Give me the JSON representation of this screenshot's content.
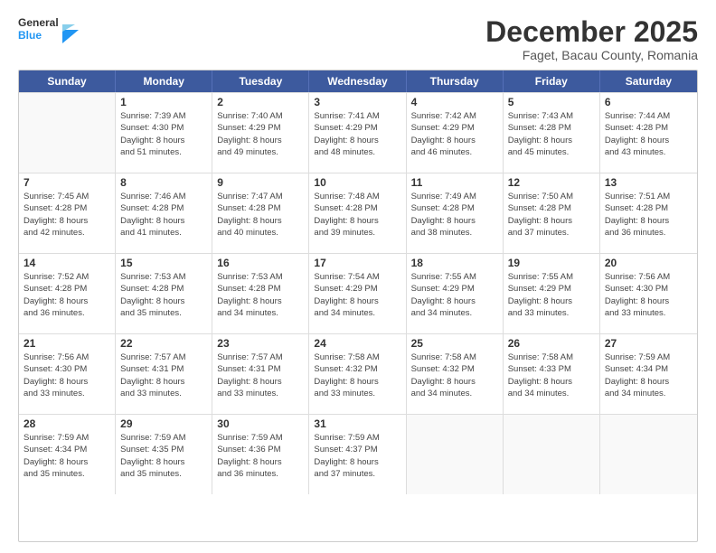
{
  "logo": {
    "line1": "General",
    "line2": "Blue"
  },
  "title": "December 2025",
  "subtitle": "Faget, Bacau County, Romania",
  "days": [
    "Sunday",
    "Monday",
    "Tuesday",
    "Wednesday",
    "Thursday",
    "Friday",
    "Saturday"
  ],
  "weeks": [
    [
      {
        "day": "",
        "sunrise": "",
        "sunset": "",
        "daylight": ""
      },
      {
        "day": "1",
        "sunrise": "Sunrise: 7:39 AM",
        "sunset": "Sunset: 4:30 PM",
        "daylight": "Daylight: 8 hours and 51 minutes."
      },
      {
        "day": "2",
        "sunrise": "Sunrise: 7:40 AM",
        "sunset": "Sunset: 4:29 PM",
        "daylight": "Daylight: 8 hours and 49 minutes."
      },
      {
        "day": "3",
        "sunrise": "Sunrise: 7:41 AM",
        "sunset": "Sunset: 4:29 PM",
        "daylight": "Daylight: 8 hours and 48 minutes."
      },
      {
        "day": "4",
        "sunrise": "Sunrise: 7:42 AM",
        "sunset": "Sunset: 4:29 PM",
        "daylight": "Daylight: 8 hours and 46 minutes."
      },
      {
        "day": "5",
        "sunrise": "Sunrise: 7:43 AM",
        "sunset": "Sunset: 4:28 PM",
        "daylight": "Daylight: 8 hours and 45 minutes."
      },
      {
        "day": "6",
        "sunrise": "Sunrise: 7:44 AM",
        "sunset": "Sunset: 4:28 PM",
        "daylight": "Daylight: 8 hours and 43 minutes."
      }
    ],
    [
      {
        "day": "7",
        "sunrise": "Sunrise: 7:45 AM",
        "sunset": "Sunset: 4:28 PM",
        "daylight": "Daylight: 8 hours and 42 minutes."
      },
      {
        "day": "8",
        "sunrise": "Sunrise: 7:46 AM",
        "sunset": "Sunset: 4:28 PM",
        "daylight": "Daylight: 8 hours and 41 minutes."
      },
      {
        "day": "9",
        "sunrise": "Sunrise: 7:47 AM",
        "sunset": "Sunset: 4:28 PM",
        "daylight": "Daylight: 8 hours and 40 minutes."
      },
      {
        "day": "10",
        "sunrise": "Sunrise: 7:48 AM",
        "sunset": "Sunset: 4:28 PM",
        "daylight": "Daylight: 8 hours and 39 minutes."
      },
      {
        "day": "11",
        "sunrise": "Sunrise: 7:49 AM",
        "sunset": "Sunset: 4:28 PM",
        "daylight": "Daylight: 8 hours and 38 minutes."
      },
      {
        "day": "12",
        "sunrise": "Sunrise: 7:50 AM",
        "sunset": "Sunset: 4:28 PM",
        "daylight": "Daylight: 8 hours and 37 minutes."
      },
      {
        "day": "13",
        "sunrise": "Sunrise: 7:51 AM",
        "sunset": "Sunset: 4:28 PM",
        "daylight": "Daylight: 8 hours and 36 minutes."
      }
    ],
    [
      {
        "day": "14",
        "sunrise": "Sunrise: 7:52 AM",
        "sunset": "Sunset: 4:28 PM",
        "daylight": "Daylight: 8 hours and 36 minutes."
      },
      {
        "day": "15",
        "sunrise": "Sunrise: 7:53 AM",
        "sunset": "Sunset: 4:28 PM",
        "daylight": "Daylight: 8 hours and 35 minutes."
      },
      {
        "day": "16",
        "sunrise": "Sunrise: 7:53 AM",
        "sunset": "Sunset: 4:28 PM",
        "daylight": "Daylight: 8 hours and 34 minutes."
      },
      {
        "day": "17",
        "sunrise": "Sunrise: 7:54 AM",
        "sunset": "Sunset: 4:29 PM",
        "daylight": "Daylight: 8 hours and 34 minutes."
      },
      {
        "day": "18",
        "sunrise": "Sunrise: 7:55 AM",
        "sunset": "Sunset: 4:29 PM",
        "daylight": "Daylight: 8 hours and 34 minutes."
      },
      {
        "day": "19",
        "sunrise": "Sunrise: 7:55 AM",
        "sunset": "Sunset: 4:29 PM",
        "daylight": "Daylight: 8 hours and 33 minutes."
      },
      {
        "day": "20",
        "sunrise": "Sunrise: 7:56 AM",
        "sunset": "Sunset: 4:30 PM",
        "daylight": "Daylight: 8 hours and 33 minutes."
      }
    ],
    [
      {
        "day": "21",
        "sunrise": "Sunrise: 7:56 AM",
        "sunset": "Sunset: 4:30 PM",
        "daylight": "Daylight: 8 hours and 33 minutes."
      },
      {
        "day": "22",
        "sunrise": "Sunrise: 7:57 AM",
        "sunset": "Sunset: 4:31 PM",
        "daylight": "Daylight: 8 hours and 33 minutes."
      },
      {
        "day": "23",
        "sunrise": "Sunrise: 7:57 AM",
        "sunset": "Sunset: 4:31 PM",
        "daylight": "Daylight: 8 hours and 33 minutes."
      },
      {
        "day": "24",
        "sunrise": "Sunrise: 7:58 AM",
        "sunset": "Sunset: 4:32 PM",
        "daylight": "Daylight: 8 hours and 33 minutes."
      },
      {
        "day": "25",
        "sunrise": "Sunrise: 7:58 AM",
        "sunset": "Sunset: 4:32 PM",
        "daylight": "Daylight: 8 hours and 34 minutes."
      },
      {
        "day": "26",
        "sunrise": "Sunrise: 7:58 AM",
        "sunset": "Sunset: 4:33 PM",
        "daylight": "Daylight: 8 hours and 34 minutes."
      },
      {
        "day": "27",
        "sunrise": "Sunrise: 7:59 AM",
        "sunset": "Sunset: 4:34 PM",
        "daylight": "Daylight: 8 hours and 34 minutes."
      }
    ],
    [
      {
        "day": "28",
        "sunrise": "Sunrise: 7:59 AM",
        "sunset": "Sunset: 4:34 PM",
        "daylight": "Daylight: 8 hours and 35 minutes."
      },
      {
        "day": "29",
        "sunrise": "Sunrise: 7:59 AM",
        "sunset": "Sunset: 4:35 PM",
        "daylight": "Daylight: 8 hours and 35 minutes."
      },
      {
        "day": "30",
        "sunrise": "Sunrise: 7:59 AM",
        "sunset": "Sunset: 4:36 PM",
        "daylight": "Daylight: 8 hours and 36 minutes."
      },
      {
        "day": "31",
        "sunrise": "Sunrise: 7:59 AM",
        "sunset": "Sunset: 4:37 PM",
        "daylight": "Daylight: 8 hours and 37 minutes."
      },
      {
        "day": "",
        "sunrise": "",
        "sunset": "",
        "daylight": ""
      },
      {
        "day": "",
        "sunrise": "",
        "sunset": "",
        "daylight": ""
      },
      {
        "day": "",
        "sunrise": "",
        "sunset": "",
        "daylight": ""
      }
    ]
  ]
}
